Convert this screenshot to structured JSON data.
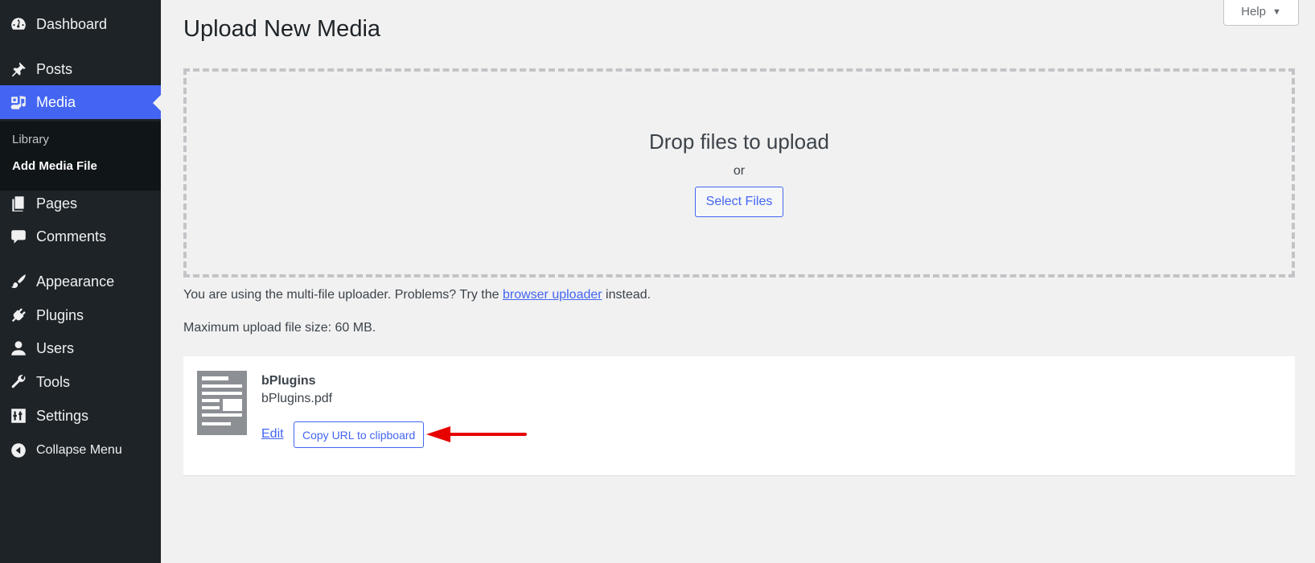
{
  "sidebar": {
    "items": [
      {
        "key": "dashboard",
        "label": "Dashboard",
        "icon": "dashboard-icon"
      },
      {
        "key": "posts",
        "label": "Posts",
        "icon": "pin-icon"
      },
      {
        "key": "media",
        "label": "Media",
        "icon": "media-icon",
        "active": true
      },
      {
        "key": "pages",
        "label": "Pages",
        "icon": "pages-icon"
      },
      {
        "key": "comments",
        "label": "Comments",
        "icon": "comment-icon"
      },
      {
        "key": "appearance",
        "label": "Appearance",
        "icon": "brush-icon"
      },
      {
        "key": "plugins",
        "label": "Plugins",
        "icon": "plug-icon"
      },
      {
        "key": "users",
        "label": "Users",
        "icon": "user-icon"
      },
      {
        "key": "tools",
        "label": "Tools",
        "icon": "wrench-icon"
      },
      {
        "key": "settings",
        "label": "Settings",
        "icon": "sliders-icon"
      },
      {
        "key": "collapse",
        "label": "Collapse Menu",
        "icon": "collapse-icon"
      }
    ],
    "submenu": [
      "Library",
      "Add Media File"
    ],
    "active_color": "#4365f2"
  },
  "header": {
    "title": "Upload New Media",
    "help_label": "Help"
  },
  "upload": {
    "drop_title": "Drop files to upload",
    "or_text": "or",
    "select_label": "Select Files",
    "info_prefix": "You are using the multi-file uploader. Problems? Try the",
    "info_link": "browser uploader",
    "info_suffix": "instead.",
    "max_size": "Maximum upload file size: 60 MB."
  },
  "media_item": {
    "title": "bPlugins",
    "filename": "bPlugins.pdf",
    "edit_label": "Edit",
    "copy_label": "Copy URL to clipboard",
    "file_icon": "document-icon"
  },
  "annotation": {
    "arrow_color": "#e60000"
  }
}
